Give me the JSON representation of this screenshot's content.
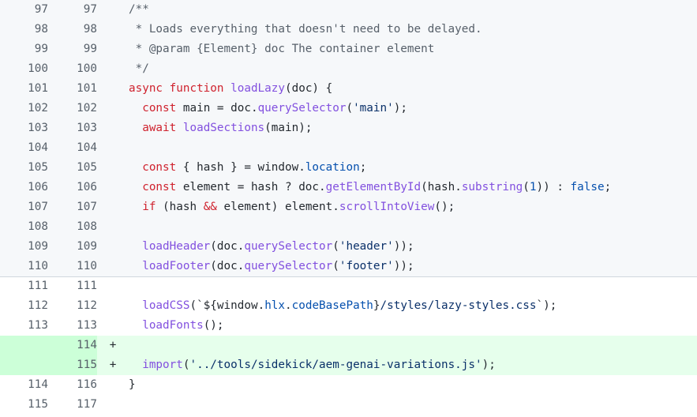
{
  "rows": [
    {
      "old": "97",
      "new": "97",
      "marker": "",
      "type": "expanded",
      "tokens": [
        [
          "com",
          "/**"
        ]
      ]
    },
    {
      "old": "98",
      "new": "98",
      "marker": "",
      "type": "expanded",
      "tokens": [
        [
          "com",
          " * Loads everything that doesn't need to be delayed."
        ]
      ]
    },
    {
      "old": "99",
      "new": "99",
      "marker": "",
      "type": "expanded",
      "tokens": [
        [
          "com",
          " * @param {Element} doc The container element"
        ]
      ]
    },
    {
      "old": "100",
      "new": "100",
      "marker": "",
      "type": "expanded",
      "tokens": [
        [
          "com",
          " */"
        ]
      ]
    },
    {
      "old": "101",
      "new": "101",
      "marker": "",
      "type": "expanded",
      "tokens": [
        [
          "kw",
          "async function "
        ],
        [
          "fn",
          "loadLazy"
        ],
        [
          "pl",
          "(doc) {"
        ]
      ]
    },
    {
      "old": "102",
      "new": "102",
      "marker": "",
      "type": "expanded",
      "tokens": [
        [
          "pl",
          "  "
        ],
        [
          "kw",
          "const"
        ],
        [
          "pl",
          " main = doc."
        ],
        [
          "fn",
          "querySelector"
        ],
        [
          "pl",
          "("
        ],
        [
          "str",
          "'main'"
        ],
        [
          "pl",
          ");"
        ]
      ]
    },
    {
      "old": "103",
      "new": "103",
      "marker": "",
      "type": "expanded",
      "tokens": [
        [
          "pl",
          "  "
        ],
        [
          "kw",
          "await"
        ],
        [
          "pl",
          " "
        ],
        [
          "fn",
          "loadSections"
        ],
        [
          "pl",
          "(main);"
        ]
      ]
    },
    {
      "old": "104",
      "new": "104",
      "marker": "",
      "type": "expanded",
      "tokens": []
    },
    {
      "old": "105",
      "new": "105",
      "marker": "",
      "type": "expanded",
      "tokens": [
        [
          "pl",
          "  "
        ],
        [
          "kw",
          "const"
        ],
        [
          "pl",
          " { hash } = window."
        ],
        [
          "prop",
          "location"
        ],
        [
          "pl",
          ";"
        ]
      ]
    },
    {
      "old": "106",
      "new": "106",
      "marker": "",
      "type": "expanded",
      "tokens": [
        [
          "pl",
          "  "
        ],
        [
          "kw",
          "const"
        ],
        [
          "pl",
          " element = hash ? doc."
        ],
        [
          "fn",
          "getElementById"
        ],
        [
          "pl",
          "(hash."
        ],
        [
          "fn",
          "substring"
        ],
        [
          "pl",
          "("
        ],
        [
          "num",
          "1"
        ],
        [
          "pl",
          ")) : "
        ],
        [
          "num",
          "false"
        ],
        [
          "pl",
          ";"
        ]
      ]
    },
    {
      "old": "107",
      "new": "107",
      "marker": "",
      "type": "expanded",
      "tokens": [
        [
          "pl",
          "  "
        ],
        [
          "kw",
          "if"
        ],
        [
          "pl",
          " (hash "
        ],
        [
          "kw",
          "&&"
        ],
        [
          "pl",
          " element) element."
        ],
        [
          "fn",
          "scrollIntoView"
        ],
        [
          "pl",
          "();"
        ]
      ]
    },
    {
      "old": "108",
      "new": "108",
      "marker": "",
      "type": "expanded",
      "tokens": []
    },
    {
      "old": "109",
      "new": "109",
      "marker": "",
      "type": "expanded",
      "tokens": [
        [
          "pl",
          "  "
        ],
        [
          "fn",
          "loadHeader"
        ],
        [
          "pl",
          "(doc."
        ],
        [
          "fn",
          "querySelector"
        ],
        [
          "pl",
          "("
        ],
        [
          "str",
          "'header'"
        ],
        [
          "pl",
          "));"
        ]
      ]
    },
    {
      "old": "110",
      "new": "110",
      "marker": "",
      "type": "expanded",
      "tokens": [
        [
          "pl",
          "  "
        ],
        [
          "fn",
          "loadFooter"
        ],
        [
          "pl",
          "(doc."
        ],
        [
          "fn",
          "querySelector"
        ],
        [
          "pl",
          "("
        ],
        [
          "str",
          "'footer'"
        ],
        [
          "pl",
          "));"
        ]
      ]
    },
    {
      "old": "111",
      "new": "111",
      "marker": "",
      "type": "normal",
      "tokens": []
    },
    {
      "old": "112",
      "new": "112",
      "marker": "",
      "type": "normal",
      "tokens": [
        [
          "pl",
          "  "
        ],
        [
          "fn",
          "loadCSS"
        ],
        [
          "pl",
          "(`"
        ],
        [
          "pl",
          "${"
        ],
        [
          "pl",
          "window."
        ],
        [
          "prop",
          "hlx"
        ],
        [
          "pl",
          "."
        ],
        [
          "prop",
          "codeBasePath"
        ],
        [
          "pl",
          "}"
        ],
        [
          "str",
          "/styles/lazy-styles.css"
        ],
        [
          "pl",
          "`);"
        ]
      ]
    },
    {
      "old": "113",
      "new": "113",
      "marker": "",
      "type": "normal",
      "tokens": [
        [
          "pl",
          "  "
        ],
        [
          "fn",
          "loadFonts"
        ],
        [
          "pl",
          "();"
        ]
      ]
    },
    {
      "old": "",
      "new": "114",
      "marker": "+",
      "type": "addition",
      "tokens": []
    },
    {
      "old": "",
      "new": "115",
      "marker": "+",
      "type": "addition",
      "tokens": [
        [
          "pl",
          "  "
        ],
        [
          "fn",
          "import"
        ],
        [
          "pl",
          "("
        ],
        [
          "str",
          "'../tools/sidekick/aem-genai-variations.js'"
        ],
        [
          "pl",
          ");"
        ]
      ]
    },
    {
      "old": "114",
      "new": "116",
      "marker": "",
      "type": "normal",
      "tokens": [
        [
          "pl",
          "}"
        ]
      ]
    },
    {
      "old": "115",
      "new": "117",
      "marker": "",
      "type": "normal",
      "tokens": []
    }
  ]
}
